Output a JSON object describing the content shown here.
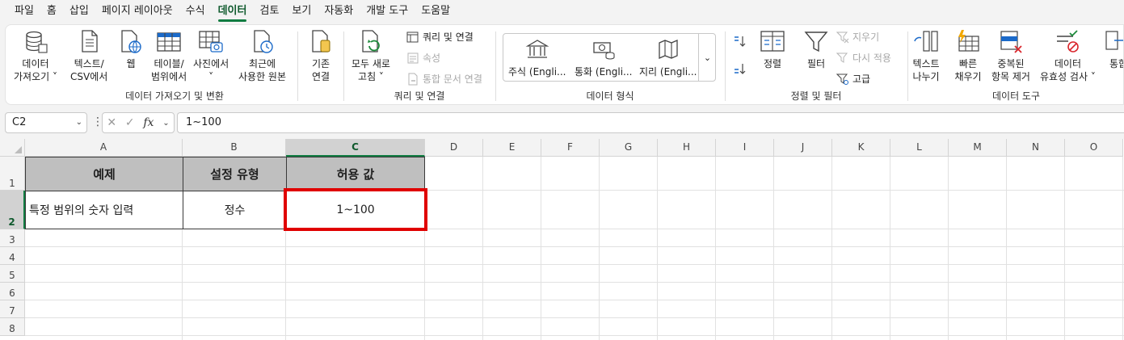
{
  "menu": {
    "tabs": [
      "파일",
      "홈",
      "삽입",
      "페이지 레이아웃",
      "수식",
      "데이터",
      "검토",
      "보기",
      "자동화",
      "개발 도구",
      "도움말"
    ],
    "active_tab": "데이터"
  },
  "ribbon": {
    "get_transform": {
      "label": "데이터 가져오기 및 변환",
      "get_data_1": "데이터",
      "get_data_2": "가져오기 ˅",
      "text_csv_1": "텍스트/",
      "text_csv_2": "CSV에서",
      "web": "웹",
      "table_range_1": "테이블/",
      "table_range_2": "범위에서",
      "picture_1": "사진에서",
      "picture_2": "˅",
      "recent_1": "최근에",
      "recent_2": "사용한 원본",
      "existing_1": "기존",
      "existing_2": "연결"
    },
    "queries": {
      "label": "쿼리 및 연결",
      "refresh_1": "모두 새로",
      "refresh_2": "고침 ˅",
      "queries_connections": "쿼리 및 연결",
      "properties": "속성",
      "edit_links": "통합 문서 연결"
    },
    "data_types": {
      "label": "데이터 형식",
      "stocks": "주식 (Engli...",
      "currencies": "통화 (Engli...",
      "geography": "지리 (Engli...",
      "more": "⌄"
    },
    "sort_filter": {
      "label": "정렬 및 필터",
      "sort": "정렬",
      "filter": "필터",
      "clear": "지우기",
      "reapply": "다시 적용",
      "advanced": "고급"
    },
    "data_tools": {
      "label": "데이터 도구",
      "text_to_cols_1": "텍스트",
      "text_to_cols_2": "나누기",
      "flash_fill_1": "빠른",
      "flash_fill_2": "채우기",
      "remove_dup_1": "중복된",
      "remove_dup_2": "항목 제거",
      "validation_1": "데이터",
      "validation_2": "유효성 검사 ˅",
      "consolidate": "통합"
    }
  },
  "formula_bar": {
    "name_box": "C2",
    "formula": "1~100",
    "fx": "fx"
  },
  "sheet": {
    "columns": [
      "A",
      "B",
      "C",
      "D",
      "E",
      "F",
      "G",
      "H",
      "I",
      "J",
      "K",
      "L",
      "M",
      "N",
      "O"
    ],
    "rows": [
      "1",
      "2",
      "3",
      "4",
      "5",
      "6",
      "7",
      "8"
    ],
    "selected_cell": "C2",
    "table": {
      "headers": [
        "예제",
        "설정 유형",
        "허용 값"
      ],
      "row": [
        "특정 범위의 숫자 입력",
        "정수",
        "1~100"
      ]
    }
  },
  "colors": {
    "accent": "#107c41",
    "highlight_border": "#e00000",
    "header_fill": "#bfbfbf"
  }
}
